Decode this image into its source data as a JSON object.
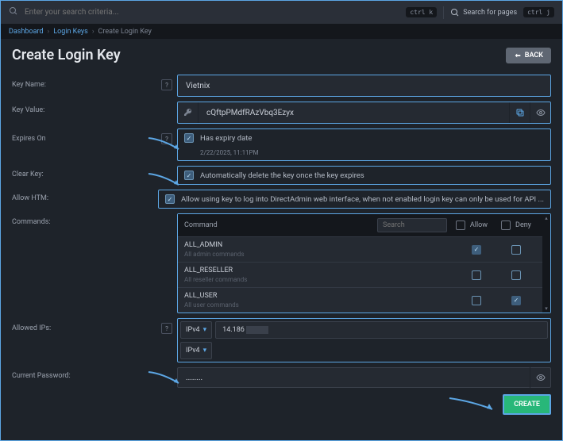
{
  "topbar": {
    "search_placeholder": "Enter your search criteria...",
    "shortcut1": "ctrl k",
    "search_pages": "Search for pages",
    "shortcut2": "ctrl j"
  },
  "breadcrumbs": {
    "a": "Dashboard",
    "b": "Login Keys",
    "c": "Create Login Key"
  },
  "header": {
    "title": "Create Login Key",
    "back": "BACK"
  },
  "labels": {
    "key_name": "Key Name:",
    "key_value": "Key Value:",
    "expires_on": "Expires On",
    "clear_key": "Clear Key:",
    "allow_htm": "Allow HTM:",
    "commands": "Commands:",
    "allowed_ips": "Allowed IPs:",
    "current_password": "Current Password:"
  },
  "fields": {
    "key_name": "Vietnix",
    "key_value": "cQftpPMdfRAzVbq3Ezyx",
    "has_expiry": "Has expiry date",
    "expiry_value": "2/22/2025, 11:11PM",
    "clear_key": "Automatically delete the key once the key expires",
    "allow_htm": "Allow using key to log into DirectAdmin web interface, when not enabled login key can only be used for API ...",
    "password": "........"
  },
  "commands": {
    "header": "Command",
    "search_placeholder": "Search",
    "allow": "Allow",
    "deny": "Deny",
    "rows": [
      {
        "name": "ALL_ADMIN",
        "desc": "All admin commands",
        "allow": true,
        "deny": false
      },
      {
        "name": "ALL_RESELLER",
        "desc": "All reseller commands",
        "allow": false,
        "deny": false
      },
      {
        "name": "ALL_USER",
        "desc": "All user commands",
        "allow": false,
        "deny": true
      }
    ]
  },
  "ips": {
    "type": "IPv4",
    "row0": "14.186",
    "row1": ""
  },
  "footer": {
    "create": "CREATE"
  }
}
